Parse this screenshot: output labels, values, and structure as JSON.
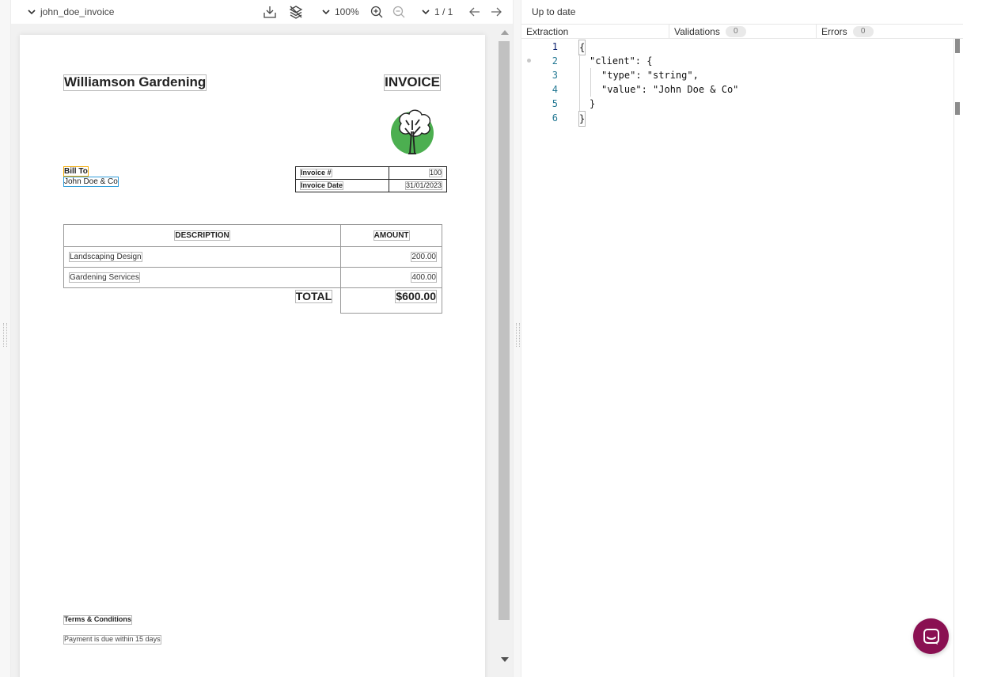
{
  "viewer": {
    "document_name": "john_doe_invoice",
    "zoom": "100%",
    "page_indicator": "1 / 1"
  },
  "invoice": {
    "company": "Williamson Gardening",
    "title": "INVOICE",
    "bill_to_label": "Bill To",
    "bill_to_name": "John Doe & Co",
    "meta": [
      {
        "label": "Invoice #",
        "value": "100"
      },
      {
        "label": "Invoice Date",
        "value": "31/01/2023"
      }
    ],
    "table_headers": {
      "description": "DESCRIPTION",
      "amount": "AMOUNT"
    },
    "items": [
      {
        "description": "Landscaping Design",
        "amount": "200.00"
      },
      {
        "description": "Gardening Services",
        "amount": "400.00"
      }
    ],
    "total_label": "TOTAL",
    "total_value": "$600.00",
    "terms_label": "Terms & Conditions",
    "terms_text": "Payment is due within 15 days"
  },
  "panel": {
    "status": "Up to date",
    "tabs": [
      {
        "label": "Extraction"
      },
      {
        "label": "Validations",
        "count": "0"
      },
      {
        "label": "Errors",
        "count": "0"
      }
    ]
  },
  "editor": {
    "lines": [
      {
        "num": "1",
        "text": "{"
      },
      {
        "num": "2",
        "text": "\"client\": {"
      },
      {
        "num": "3",
        "text": "\"type\": \"string\","
      },
      {
        "num": "4",
        "text": "\"value\": \"John Doe & Co\""
      },
      {
        "num": "5",
        "text": "}"
      },
      {
        "num": "6",
        "text": "}"
      }
    ]
  },
  "colors": {
    "accent_chat": "#8a1052",
    "bill_to_label_border": "#f2a900",
    "bill_to_name_border": "#2e9bd8",
    "logo_green": "#4caf50"
  }
}
